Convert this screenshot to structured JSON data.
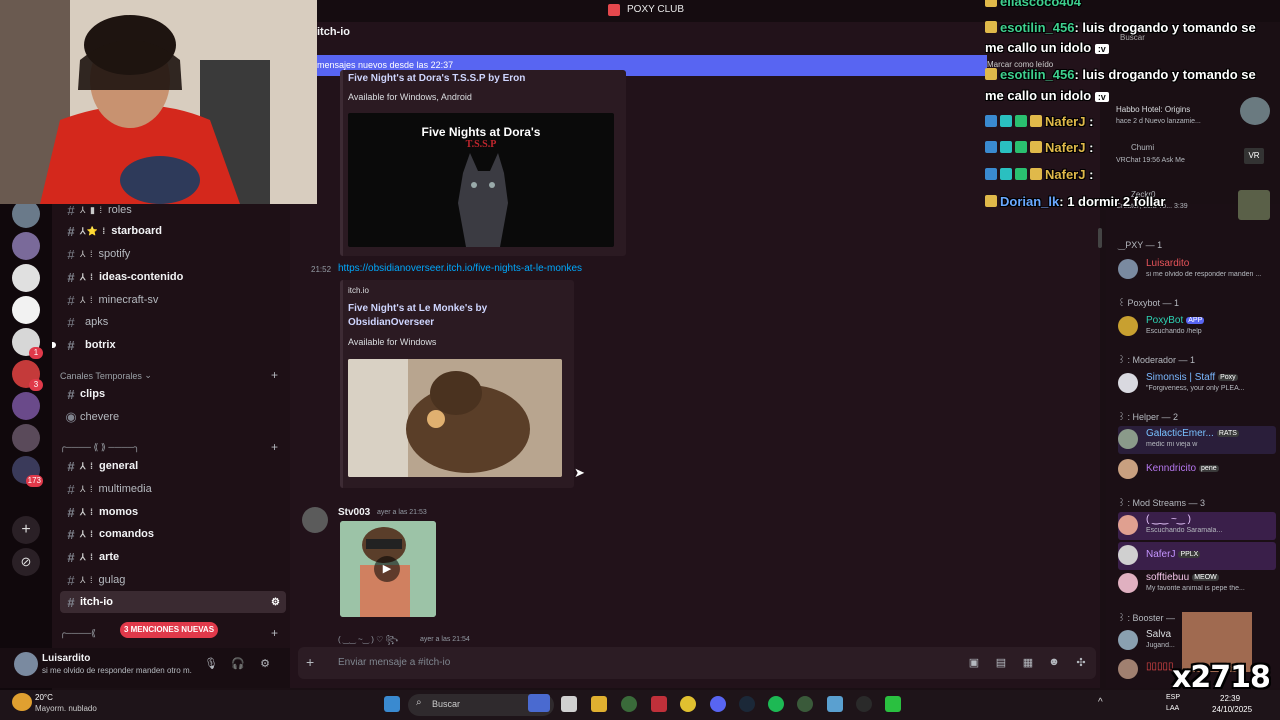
{
  "titlebar": {
    "title": "POXY CLUB"
  },
  "channel_header": {
    "name": "itch-io"
  },
  "new_messages_bar": {
    "text": "mensajes nuevos desde las 22:37",
    "mark_read": "Marcar como leído"
  },
  "channels": [
    {
      "emoji": "⅄ ▮ ⁞",
      "label": "roles",
      "bold": false
    },
    {
      "emoji": "⅄⭐ ⁞",
      "label": "starboard",
      "bold": true
    },
    {
      "emoji": "⅄ ⁞",
      "label": "spotify",
      "bold": false
    },
    {
      "emoji": "⅄ ⁞",
      "label": "ideas-contenido",
      "bold": true
    },
    {
      "emoji": "⅄ ⁞",
      "label": "minecraft-sv",
      "bold": false
    },
    {
      "emoji": "",
      "label": "apks",
      "bold": false
    },
    {
      "emoji": "",
      "label": "botrix",
      "bold": true
    }
  ],
  "category_temp": {
    "label": "Canales Temporales"
  },
  "temp_channels": [
    {
      "label": "clips"
    },
    {
      "label": "chevere"
    }
  ],
  "category_deco": {
    "label": "╭──── ⟪ ⟫ ────╮"
  },
  "channels2": [
    {
      "emoji": "⅄ ⁞",
      "label": "general",
      "bold": true
    },
    {
      "emoji": "⅄ ⁞",
      "label": "multimedia",
      "bold": false
    },
    {
      "emoji": "⅄ ⁞",
      "label": "momos",
      "bold": true
    },
    {
      "emoji": "⅄ ⁞",
      "label": "comandos",
      "bold": true
    },
    {
      "emoji": "⅄ ⁞",
      "label": "arte",
      "bold": true
    },
    {
      "emoji": "⅄ ⁞",
      "label": "gulag",
      "bold": false
    },
    {
      "emoji": "",
      "label": "itch-io",
      "bold": true
    }
  ],
  "mentions_pill": "3 MENCIONES NUEVAS",
  "user": {
    "name": "Luisardito",
    "status": "si me olvido de responder manden otro m..."
  },
  "server_badges": [
    "1",
    "3",
    "173"
  ],
  "embed1": {
    "title": "Five Night's at Dora's T.S.S.P by Eron",
    "platforms": "Available for Windows, Android",
    "image_title": "Five Nights at Dora's",
    "image_sub": "T.S.S.P"
  },
  "message1": {
    "time": "21:52",
    "link": "https://obsidianoverseer.itch.io/five-nights-at-le-monkes"
  },
  "embed2": {
    "provider": "itch.io",
    "title": "Five Night's at Le Monke's by ObsidianOverseer",
    "platforms": "Available for Windows"
  },
  "message2": {
    "author": "Stv003",
    "time": "ayer a las 21:53"
  },
  "message3": {
    "author": "( ‿‿ ~‿ ) ♡ ꧂",
    "time": "ayer a las 21:54"
  },
  "composer": {
    "placeholder": "Enviar mensaje a #itch-io"
  },
  "members": {
    "categories": [
      {
        "label": "‿PXY — 1"
      },
      {
        "label": "꒰ Poxybot — 1"
      },
      {
        "label": "꒱ : Moderador — 1"
      },
      {
        "label": "꒱ : Helper — 2"
      },
      {
        "label": "꒱ : Mod Streams — 3"
      },
      {
        "label": "꒱ : Booster —"
      }
    ],
    "list": [
      {
        "name": "Luisardito",
        "status": "si me olvido de responder manden ...",
        "color": "#e8545a",
        "tag": ""
      },
      {
        "name": "PoxyBot",
        "status": "Escuchando /help",
        "color": "#2dd2b3",
        "tag": "APP"
      },
      {
        "name": "Simonsis | Staff",
        "status": "\"Forgiveness, your only PLEA...",
        "color": "#7ab8ff",
        "tag": "Poxy"
      },
      {
        "name": "GalacticEmer...",
        "status": "medic mi vieja w",
        "color": "#78c0ff",
        "tag": "RATS"
      },
      {
        "name": "Kenndricito",
        "status": "",
        "color": "#b678f0",
        "tag": "pene"
      },
      {
        "name": "( ‿‿ ~‿ )",
        "status": "Escuchando Saramala...",
        "color": "#e8c7ff",
        "tag": ""
      },
      {
        "name": "NaferJ",
        "status": "",
        "color": "#c495ff",
        "tag": "PPLX"
      },
      {
        "name": "sofftiebuu",
        "status": "My favorite animal is pepe the...",
        "color": "#f2c4e8",
        "tag": "MEOW"
      },
      {
        "name": "Salva",
        "status": "Jugand...",
        "color": "#dbdee1",
        "tag": ""
      },
      {
        "name": "▯▯▯▯▯",
        "status": "",
        "color": "#f04b4b",
        "tag": ""
      }
    ]
  },
  "activity_cards": [
    {
      "title": "Habbo Hotel: Origins",
      "sub": "hace 2 d  Nuevo lanzamie..."
    },
    {
      "title": "Chumi",
      "sub": "VRChat  19:56  Ask Me"
    },
    {
      "title": "Zeckr0",
      "sub": "Creator; Lola Yo...  3:39"
    }
  ],
  "chat_overlay": [
    {
      "user": "ellascoco404",
      "text": "",
      "ucls": "u"
    },
    {
      "user": "esotilin_456",
      "text": ": luis drogando y tomando se",
      "ucls": "u"
    },
    {
      "user": "",
      "text": "me callo un idolo",
      "ucls": "u",
      "tail": ":v"
    },
    {
      "user": "esotilin_456",
      "text": ": luis drogando y tomando se",
      "ucls": "u"
    },
    {
      "user": "",
      "text": "me callo un idolo",
      "ucls": "u",
      "tail": ":v"
    },
    {
      "user": "NaferJ",
      "text": " :",
      "ucls": "u2"
    },
    {
      "user": "NaferJ",
      "text": " :",
      "ucls": "u2"
    },
    {
      "user": "NaferJ",
      "text": " :",
      "ucls": "u2"
    },
    {
      "user": "Dorian_lk",
      "text": ": 1 dormir 2 follar",
      "ucls": "u3"
    }
  ],
  "taskbar": {
    "temp": "20°C",
    "weather": "Mayorm. nublado",
    "search": "Buscar",
    "lang1": "ESP",
    "lang2": "LAA",
    "time": "22:39",
    "date": "24/10/2025"
  },
  "top_search": "Buscar",
  "watermark": "x2718",
  "colors": {
    "accent": "#5865f2",
    "mention": "#e0394a",
    "link": "#00a8fc",
    "chat_user": "#3ecf8e"
  }
}
